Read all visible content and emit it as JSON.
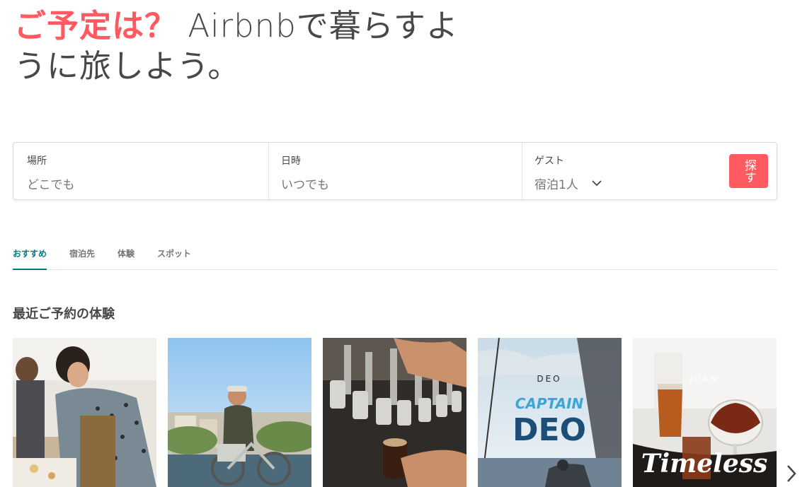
{
  "hero": {
    "accent": "ご予定は？",
    "rest": " Airbnbで暮らすように旅しよう。"
  },
  "search": {
    "location": {
      "label": "場所",
      "value": "どこでも"
    },
    "dates": {
      "label": "日時",
      "value": "いつでも"
    },
    "guests": {
      "label": "ゲスト",
      "value": "宿泊1人"
    },
    "button": "探す"
  },
  "tabs": [
    {
      "label": "おすすめ",
      "active": true
    },
    {
      "label": "宿泊先",
      "active": false
    },
    {
      "label": "体験",
      "active": false
    },
    {
      "label": "スポット",
      "active": false
    }
  ],
  "section": {
    "title": "最近ご予約の体験"
  },
  "cards": [
    {
      "icon": "cooking-class-photo"
    },
    {
      "icon": "bike-tour-photo"
    },
    {
      "icon": "beer-tap-photo"
    },
    {
      "icon": "sailing-poster-photo",
      "overline": "DEO",
      "title_line1": "CAPTAIN",
      "title_line2": "DEO"
    },
    {
      "icon": "cocktail-poster-photo",
      "overline": "JUAN",
      "title_line1": "Timeless"
    }
  ],
  "colors": {
    "brand": "#FF5A5F",
    "tab_active": "#007A87",
    "text": "#484848",
    "muted": "#767676"
  }
}
